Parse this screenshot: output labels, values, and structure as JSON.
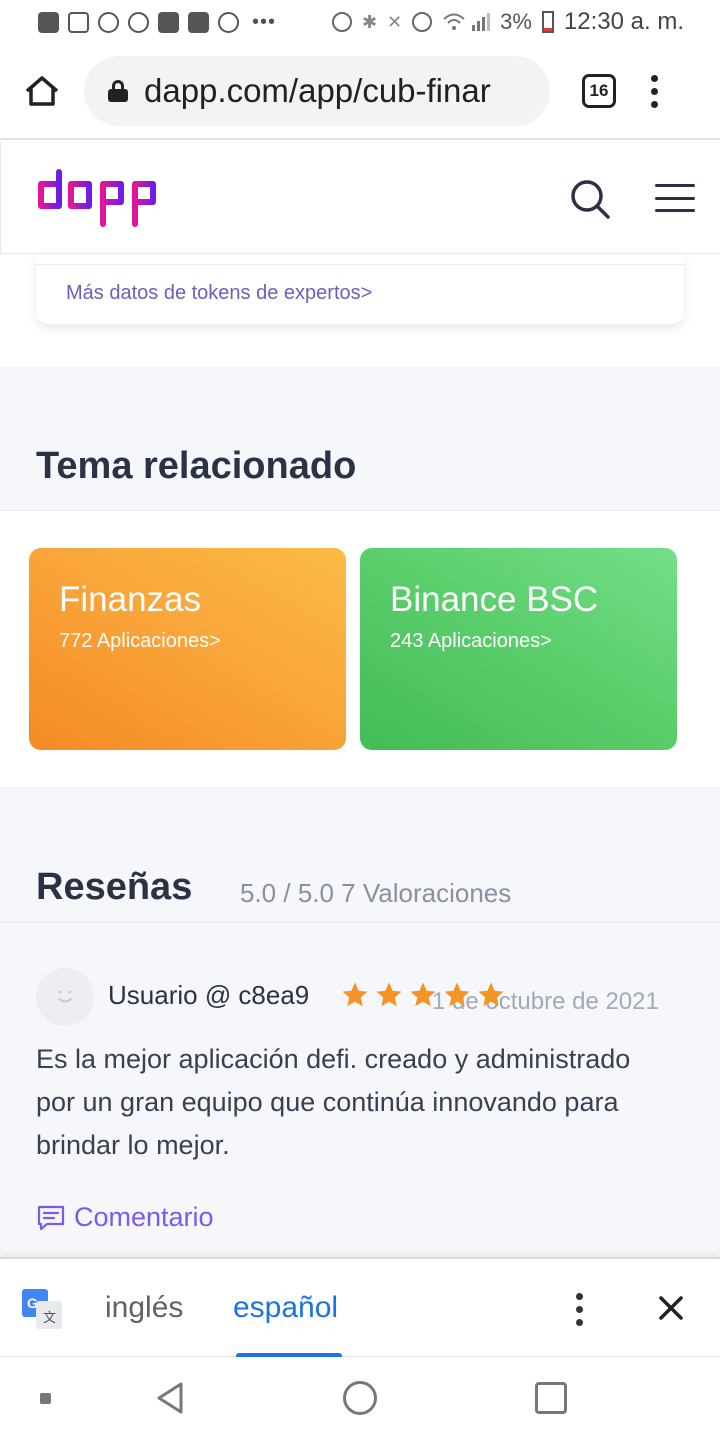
{
  "status_bar": {
    "battery": "3%",
    "time": "12:30 a. m.",
    "dots": "•••"
  },
  "browser": {
    "url": "dapp.com/app/cub-finar",
    "tab_count": "16"
  },
  "site": {
    "logo_text": "dapp",
    "brand_colors": {
      "pink": "#e3169a",
      "purple": "#6e1ce6"
    }
  },
  "token_card": {
    "link": "Más datos de tokens de expertos>"
  },
  "related": {
    "title": "Tema relacionado",
    "topics": [
      {
        "name": "Finanzas",
        "count": "772 Aplicaciones>",
        "color": "#f7a035"
      },
      {
        "name": "Binance BSC",
        "count": "243 Aplicaciones>",
        "color": "#58c96a"
      }
    ]
  },
  "reviews": {
    "title": "Reseñas",
    "summary": "5.0 / 5.0 7 Valoraciones",
    "items": [
      {
        "user": "Usuario @ c8ea9",
        "stars": 5,
        "date": "1 de octubre de 2021",
        "text": "Es la mejor aplicación defi. creado y administrado por un gran equipo que continúa innovando para brindar lo mejor.",
        "comment_label": "Comentario"
      }
    ]
  },
  "translate_bar": {
    "source_lang": "inglés",
    "target_lang": "español",
    "active": "español"
  },
  "icons": {
    "home": "home-icon",
    "lock": "lock-icon",
    "search": "search-icon",
    "menu": "hamburger-menu-icon",
    "translate": "google-translate-icon",
    "close": "close-icon"
  }
}
